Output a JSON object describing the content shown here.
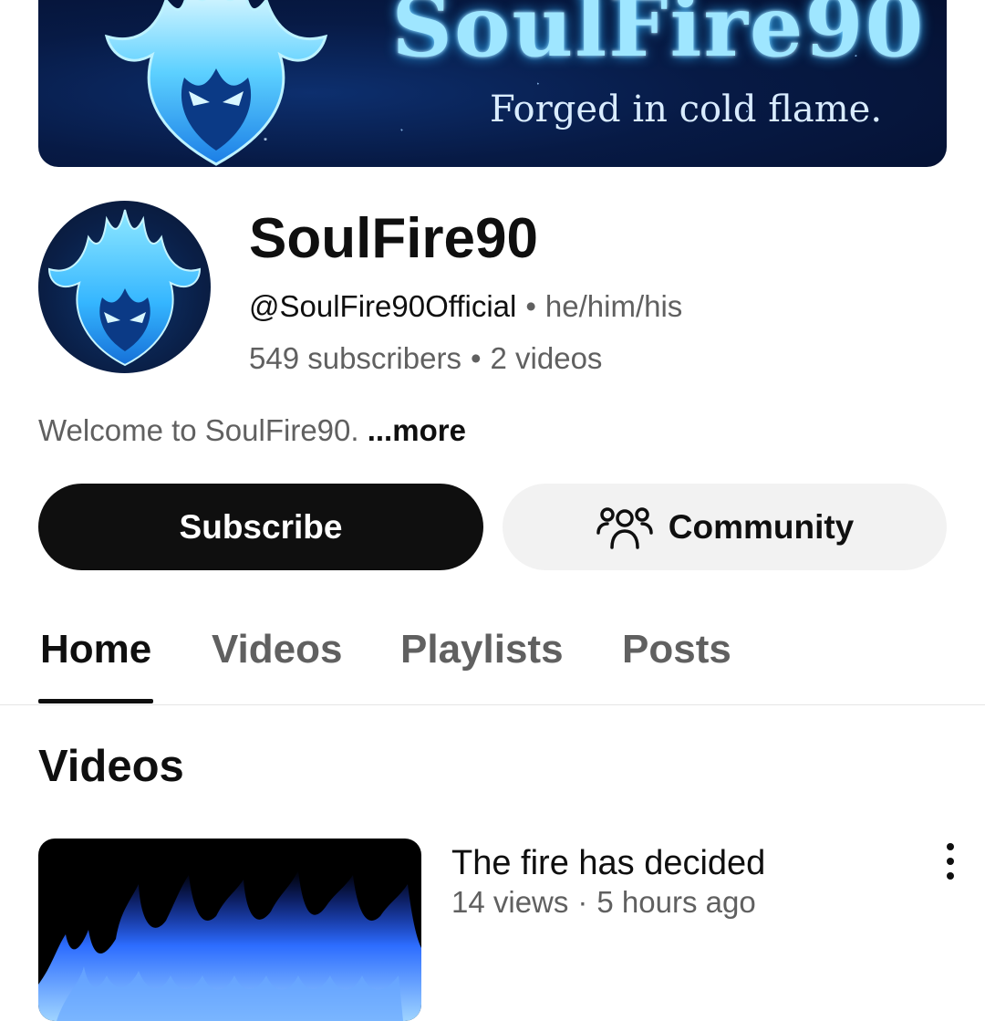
{
  "banner": {
    "title": "SoulFire90",
    "tagline": "Forged in cold flame."
  },
  "channel": {
    "name": "SoulFire90",
    "handle": "@SoulFire90Official",
    "pronouns": "he/him/his",
    "subscribers": "549 subscribers",
    "videos": "2 videos",
    "description": "Welcome to SoulFire90.",
    "more_label": "...more",
    "separator": "•"
  },
  "actions": {
    "subscribe_label": "Subscribe",
    "community_label": "Community",
    "community_icon": "community-people-icon"
  },
  "tabs": [
    {
      "label": "Home",
      "active": true
    },
    {
      "label": "Videos",
      "active": false
    },
    {
      "label": "Playlists",
      "active": false
    },
    {
      "label": "Posts",
      "active": false
    }
  ],
  "section": {
    "title": "Videos"
  },
  "video": {
    "title": "The fire has decided",
    "views": "14 views",
    "separator": "·",
    "age": "5 hours ago",
    "menu_icon": "more-vert-icon"
  },
  "colors": {
    "accent_flame": "#2fb4ff",
    "banner_bg": "#071a45",
    "subscribe_bg": "#0f0f0f",
    "community_bg": "#f2f2f2"
  }
}
